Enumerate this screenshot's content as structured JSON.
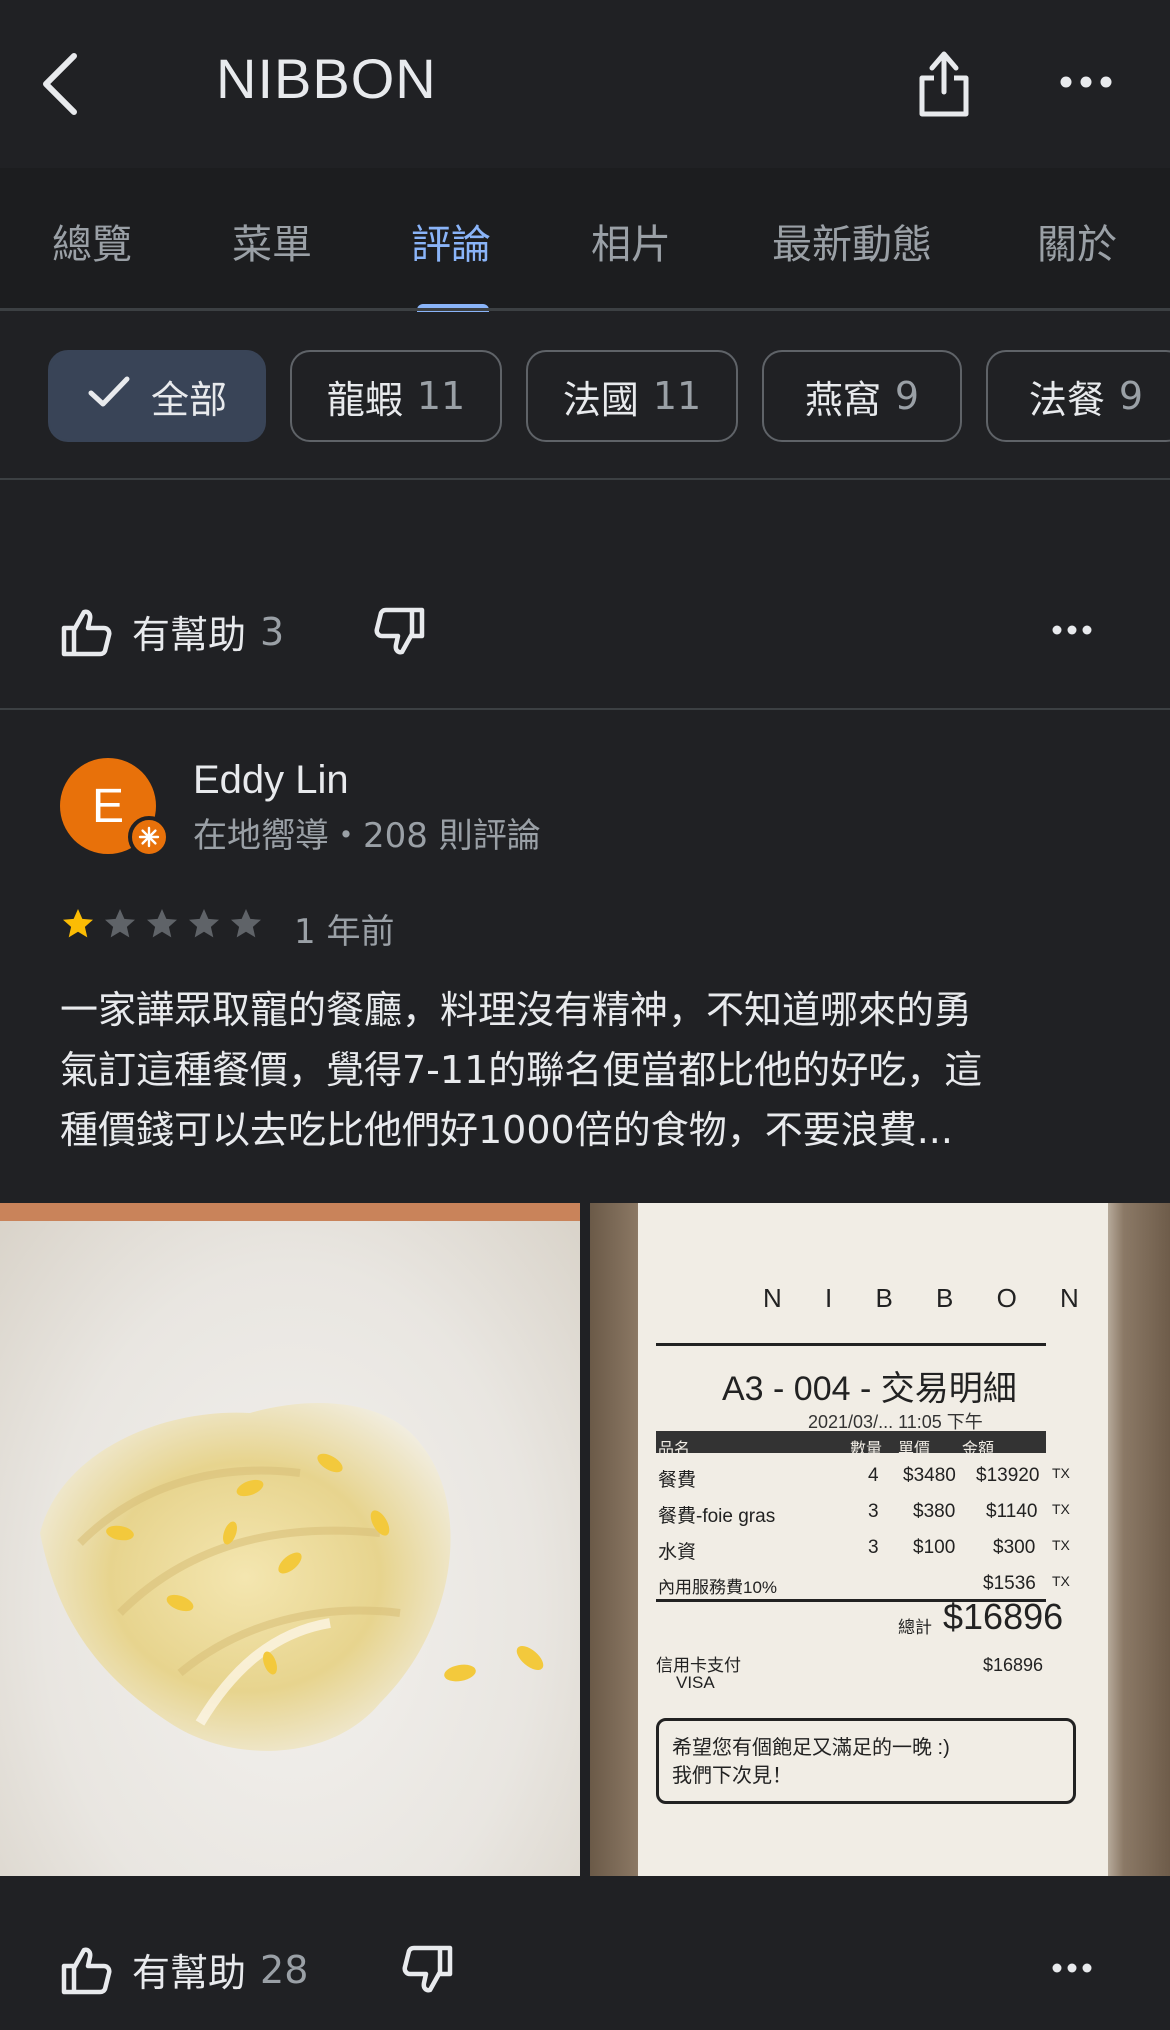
{
  "header": {
    "title": "NIBBON"
  },
  "tabs": [
    {
      "label": "總覽"
    },
    {
      "label": "菜單"
    },
    {
      "label": "評論",
      "active": true
    },
    {
      "label": "相片"
    },
    {
      "label": "最新動態"
    },
    {
      "label": "關於"
    }
  ],
  "chips": [
    {
      "label": "全部",
      "count": "",
      "selected": true
    },
    {
      "label": "龍蝦",
      "count": "11"
    },
    {
      "label": "法國",
      "count": "11"
    },
    {
      "label": "燕窩",
      "count": "9"
    },
    {
      "label": "法餐",
      "count": "9"
    }
  ],
  "prev_review_actions": {
    "helpful_label": "有幫助",
    "helpful_count": "3"
  },
  "review": {
    "avatar_letter": "E",
    "name": "Eddy Lin",
    "meta": "在地嚮導・208 則評論",
    "rating": 1,
    "max_rating": 5,
    "date": "1 年前",
    "text_lines": [
      "一家譁眾取寵的餐廳，料理沒有精神，不知道哪來的勇",
      "氣訂這種餐價，覺得7-11的聯名便當都比他的好吃，這",
      "種價錢可以去吃比他們好1000倍的食物，不要浪費..."
    ],
    "helpful_label": "有幫助",
    "helpful_count": "28"
  },
  "receipt": {
    "brand": "N I B B O N",
    "title": "A3 - 004 - 交易明細",
    "time": "2021/03/... 11:05 下午",
    "header": "品名　　　　　　　　　　數量　單價　　金額",
    "rows": [
      {
        "name": "餐費",
        "qty": "4",
        "price": "$3480",
        "amount": "$13920",
        "tax": "TX"
      },
      {
        "name": "餐費-foie gras",
        "qty": "3",
        "price": "$380",
        "amount": "$1140",
        "tax": "TX"
      },
      {
        "name": "水資",
        "qty": "3",
        "price": "$100",
        "amount": "$300",
        "tax": "TX"
      },
      {
        "name": "內用服務費10%",
        "qty": "",
        "price": "",
        "amount": "$1536",
        "tax": "TX"
      }
    ],
    "total_label": "總計",
    "total": "$16896",
    "pay_label": "信用卡支付",
    "pay_card": "VISA",
    "paid": "$16896",
    "message_line1": "希望您有個飽足又滿足的一晚 :)",
    "message_line2": "我們下次見！"
  },
  "colors": {
    "background": "#202124",
    "accent": "#8ab4f8",
    "star_filled": "#fbbc04",
    "star_empty": "#5f6368",
    "avatar": "#e8710a"
  }
}
